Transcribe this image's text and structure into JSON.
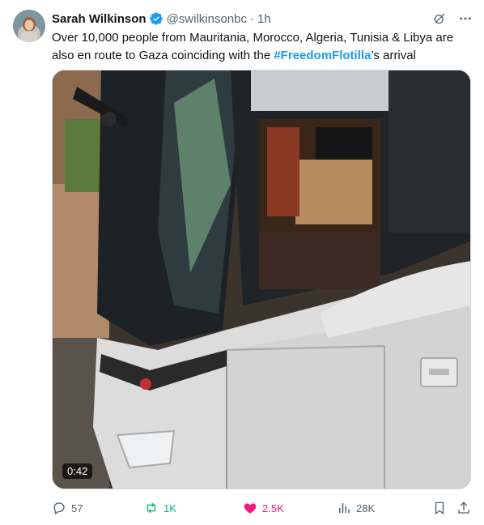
{
  "author": {
    "name": "Sarah Wilkinson",
    "handle": "@swilkinsonbc",
    "separator": "·",
    "time": "1h"
  },
  "tweet": {
    "text_line1": "Over 10,000 people from Mauritania, Morocco, Algeria, Tunisia & Libya are",
    "text_line2_before": "also en route to Gaza coinciding with the ",
    "hashtag": "#FreedomFlotilla",
    "text_line2_after": "’s arrival"
  },
  "media": {
    "duration": "0:42"
  },
  "actions": {
    "replies": "57",
    "retweets": "1K",
    "likes": "2.5K",
    "views": "28K"
  },
  "colors": {
    "accent": "#1d9bf0",
    "like": "#f91880",
    "retweet": "#00ba7c",
    "muted": "#536471"
  },
  "icons": {
    "verified": "verified-badge-icon",
    "grok": "grok-icon",
    "more": "more-icon",
    "reply": "reply-icon",
    "retweet": "retweet-icon",
    "like": "heart-icon",
    "views": "views-icon",
    "bookmark": "bookmark-icon",
    "share": "share-icon"
  }
}
